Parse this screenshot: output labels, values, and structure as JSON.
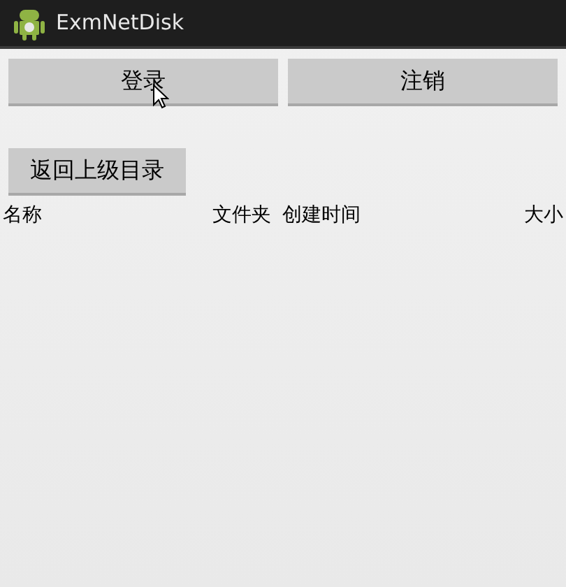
{
  "window": {
    "title": "ExmNetDisk"
  },
  "buttons": [
    "登录",
    "注销"
  ],
  "back_button": "返回上级目录",
  "table": {
    "columns": [
      "名称",
      "文件夹",
      "创建时间",
      "大小"
    ]
  }
}
